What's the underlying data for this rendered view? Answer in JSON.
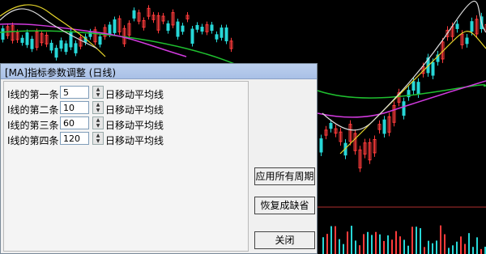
{
  "dialog": {
    "title": "[MA]指标参数调整 (日线)"
  },
  "params": [
    {
      "label": "I线的第一条",
      "value": "5",
      "unit": "日移动平均线"
    },
    {
      "label": "I线的第二条",
      "value": "10",
      "unit": "日移动平均线"
    },
    {
      "label": "I线的第三条",
      "value": "60",
      "unit": "日移动平均线"
    },
    {
      "label": "I线的第四条",
      "value": "120",
      "unit": "日移动平均线"
    }
  ],
  "buttons": {
    "apply_all": "应用所有周期",
    "restore": "恢复成缺省",
    "close": "关闭"
  },
  "colors": {
    "background": "#000000",
    "ma_green": "#1fbf2f",
    "ma_magenta": "#d23adf",
    "ma_yellow": "#e6d52a",
    "ma_white": "#dddddd",
    "candle_up": "#ff3b3b",
    "candle_down": "#27d7d7",
    "titlebar": "#b4c8ea"
  }
}
